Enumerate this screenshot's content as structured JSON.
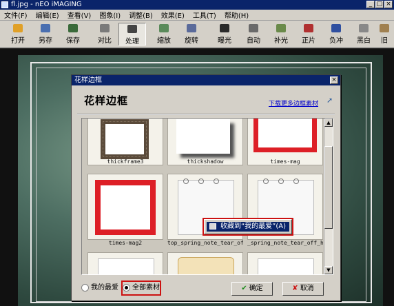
{
  "window": {
    "title": "fl.jpg - nEO iMAGING",
    "buttons": [
      "_",
      "□",
      "×"
    ]
  },
  "menu": [
    "文件(F)",
    "编辑(E)",
    "查看(V)",
    "图象(I)",
    "调整(B)",
    "效果(E)",
    "工具(T)",
    "帮助(H)"
  ],
  "toolbar": [
    {
      "label": "打开",
      "icon": "open-icon",
      "color": "#e0a028"
    },
    {
      "label": "另存",
      "icon": "save-as-icon",
      "color": "#4a6fb0"
    },
    {
      "label": "保存",
      "icon": "save-icon",
      "color": "#3a6a3a"
    },
    {
      "label": "对比",
      "icon": "compare-icon",
      "color": "#7a7a7a"
    },
    {
      "label": "处理",
      "icon": "process-icon",
      "color": "#444444",
      "active": true
    },
    {
      "label": "缩放",
      "icon": "zoom-icon",
      "color": "#5a8a5a"
    },
    {
      "label": "旋转",
      "icon": "rotate-icon",
      "color": "#5a6a9a"
    },
    {
      "label": "曝光",
      "icon": "exposure-icon",
      "color": "#2a2a2a"
    },
    {
      "label": "自动",
      "icon": "auto-icon",
      "color": "#6a6a6a"
    },
    {
      "label": "补光",
      "icon": "fill-light-icon",
      "color": "#6a8a4a"
    },
    {
      "label": "正片",
      "icon": "positive-film-icon",
      "color": "#b03030"
    },
    {
      "label": "负冲",
      "icon": "cross-process-icon",
      "color": "#3050a0"
    },
    {
      "label": "黑白",
      "icon": "black-white-icon",
      "color": "#888888"
    },
    {
      "label": "旧",
      "icon": "old-photo-icon",
      "color": "#a08050"
    }
  ],
  "dialog": {
    "title": "花样边框",
    "heading": "花样边框",
    "link": "下载更多边框素材",
    "link_icon": "cursor-icon",
    "frames": [
      {
        "label": "thickframe3",
        "style": "ornate"
      },
      {
        "label": "thickshadow",
        "style": "shadow"
      },
      {
        "label": "times-mag",
        "style": "red"
      },
      {
        "label": "times-mag2",
        "style": "red"
      },
      {
        "label": "top_spring_note_tear_off",
        "style": "note"
      },
      {
        "label": "_spring_note_tear_off_hx",
        "style": "note"
      },
      {
        "label": "",
        "style": "plain"
      },
      {
        "label": "",
        "style": "scroll"
      },
      {
        "label": "",
        "style": "plain"
      }
    ],
    "context_menu": {
      "label": "收藏到“我的最爱”(A)",
      "icon": "favorite-icon"
    },
    "radio_favorites": "我的最爱",
    "radio_all": "全部素材",
    "ok": "确定",
    "cancel": "取消",
    "accent": "#cc1111"
  }
}
